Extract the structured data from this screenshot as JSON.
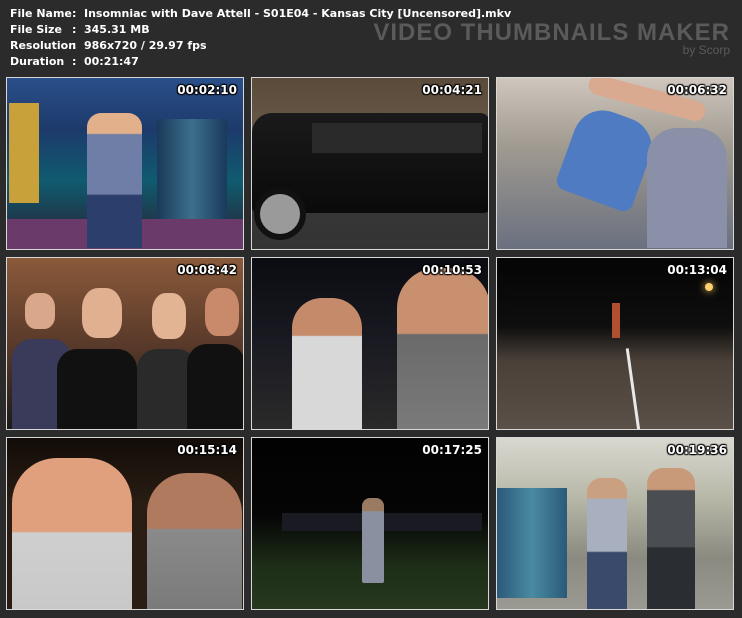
{
  "meta": {
    "rows": [
      {
        "key": "File Name",
        "sep": ":",
        "value": "Insomniac with Dave Attell - S01E04 - Kansas City [Uncensored].mkv"
      },
      {
        "key": "File Size",
        "sep": ":",
        "value": "345.31 MB"
      },
      {
        "key": "Resolution",
        "sep": ":",
        "value": "986x720 / 29.97 fps"
      },
      {
        "key": "Duration",
        "sep": ":",
        "value": "00:21:47"
      }
    ]
  },
  "brand": {
    "title": "VIDEO THUMBNAILS MAKER",
    "subtitle": "by Scorp"
  },
  "thumbnails": [
    {
      "timestamp": "00:02:10"
    },
    {
      "timestamp": "00:04:21"
    },
    {
      "timestamp": "00:06:32"
    },
    {
      "timestamp": "00:08:42"
    },
    {
      "timestamp": "00:10:53"
    },
    {
      "timestamp": "00:13:04"
    },
    {
      "timestamp": "00:15:14"
    },
    {
      "timestamp": "00:17:25"
    },
    {
      "timestamp": "00:19:36"
    }
  ],
  "colors": {
    "background": "#2b2b2b",
    "text": "#ffffff",
    "watermark": "#5a5a5a",
    "thumb_border": "#d8d8d8"
  }
}
